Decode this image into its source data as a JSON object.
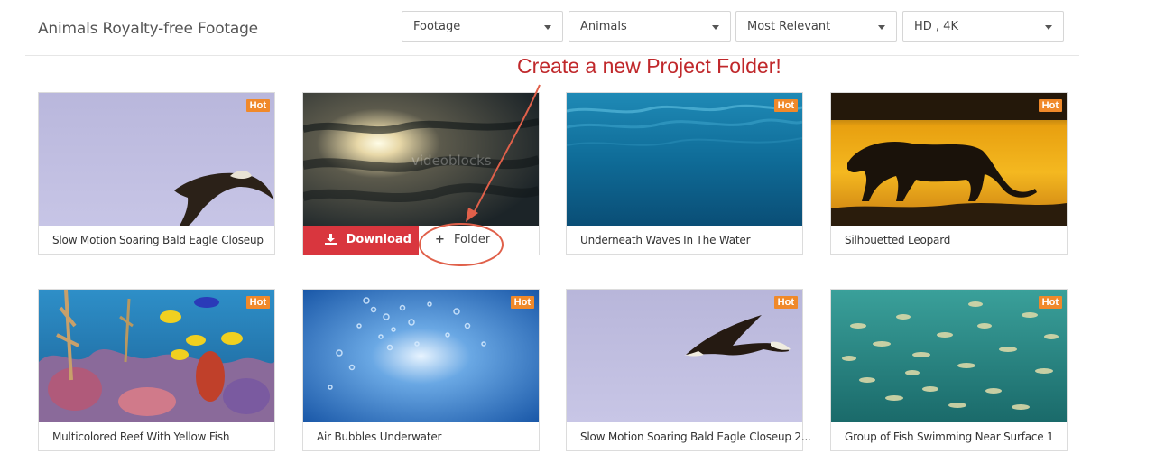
{
  "header": {
    "title": "Animals Royalty-free Footage"
  },
  "filters": [
    {
      "name": "category-select",
      "value": "Footage"
    },
    {
      "name": "subject-select",
      "value": "Animals"
    },
    {
      "name": "sort-select",
      "value": "Most Relevant"
    },
    {
      "name": "resolution-select",
      "value": "HD , 4K"
    }
  ],
  "annotation": {
    "text": "Create a new Project Folder!",
    "color": "#c0282b"
  },
  "badge_label": "Hot",
  "hover_actions": {
    "download_label": "Download",
    "folder_label": "Folder"
  },
  "clips": [
    {
      "title": "Slow Motion Soaring Bald Eagle Closeup",
      "hot": true
    },
    {
      "title": "",
      "hot": false,
      "watermark": "videoblocks"
    },
    {
      "title": "Underneath Waves In The Water",
      "hot": true
    },
    {
      "title": "Silhouetted Leopard",
      "hot": true
    },
    {
      "title": "Multicolored Reef With Yellow Fish",
      "hot": true
    },
    {
      "title": "Air Bubbles Underwater",
      "hot": true
    },
    {
      "title": "Slow Motion Soaring Bald Eagle Closeup 2...",
      "hot": true
    },
    {
      "title": "Group of Fish Swimming Near Surface 1",
      "hot": true
    }
  ],
  "colors": {
    "hot_badge": "#f0892a",
    "download_button": "#d9363e",
    "annotation": "#c0282b"
  }
}
